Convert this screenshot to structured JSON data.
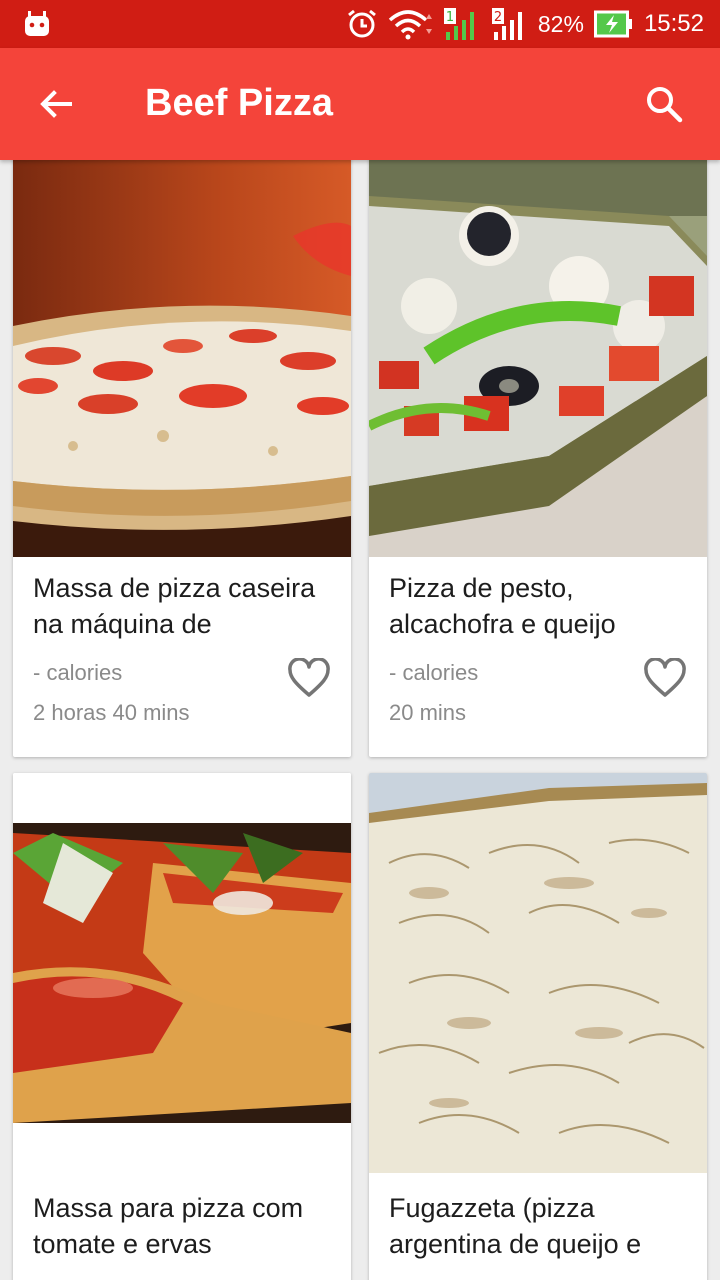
{
  "status_bar": {
    "battery": "82%",
    "time": "15:52",
    "sim1": "1",
    "sim2": "2",
    "icons": [
      "android-icon",
      "alarm-icon",
      "wifi-icon",
      "signal-icon",
      "battery-charging-icon"
    ]
  },
  "app_bar": {
    "title": "Beef Pizza",
    "back_icon": "arrow-back-icon",
    "search_icon": "search-icon"
  },
  "recipes": [
    {
      "title": "Massa de pizza caseira na máquina de",
      "calories": "- calories",
      "time": "2 horas 40 mins"
    },
    {
      "title": "Pizza de pesto, alcachofra e queijo",
      "calories": "- calories",
      "time": "20 mins"
    },
    {
      "title": "Massa para pizza com tomate e ervas",
      "calories": "",
      "time": ""
    },
    {
      "title": "Fugazzeta (pizza argentina de queijo e",
      "calories": "",
      "time": ""
    }
  ],
  "colors": {
    "primary": "#f4443a",
    "primary_dark": "#d01d14"
  }
}
